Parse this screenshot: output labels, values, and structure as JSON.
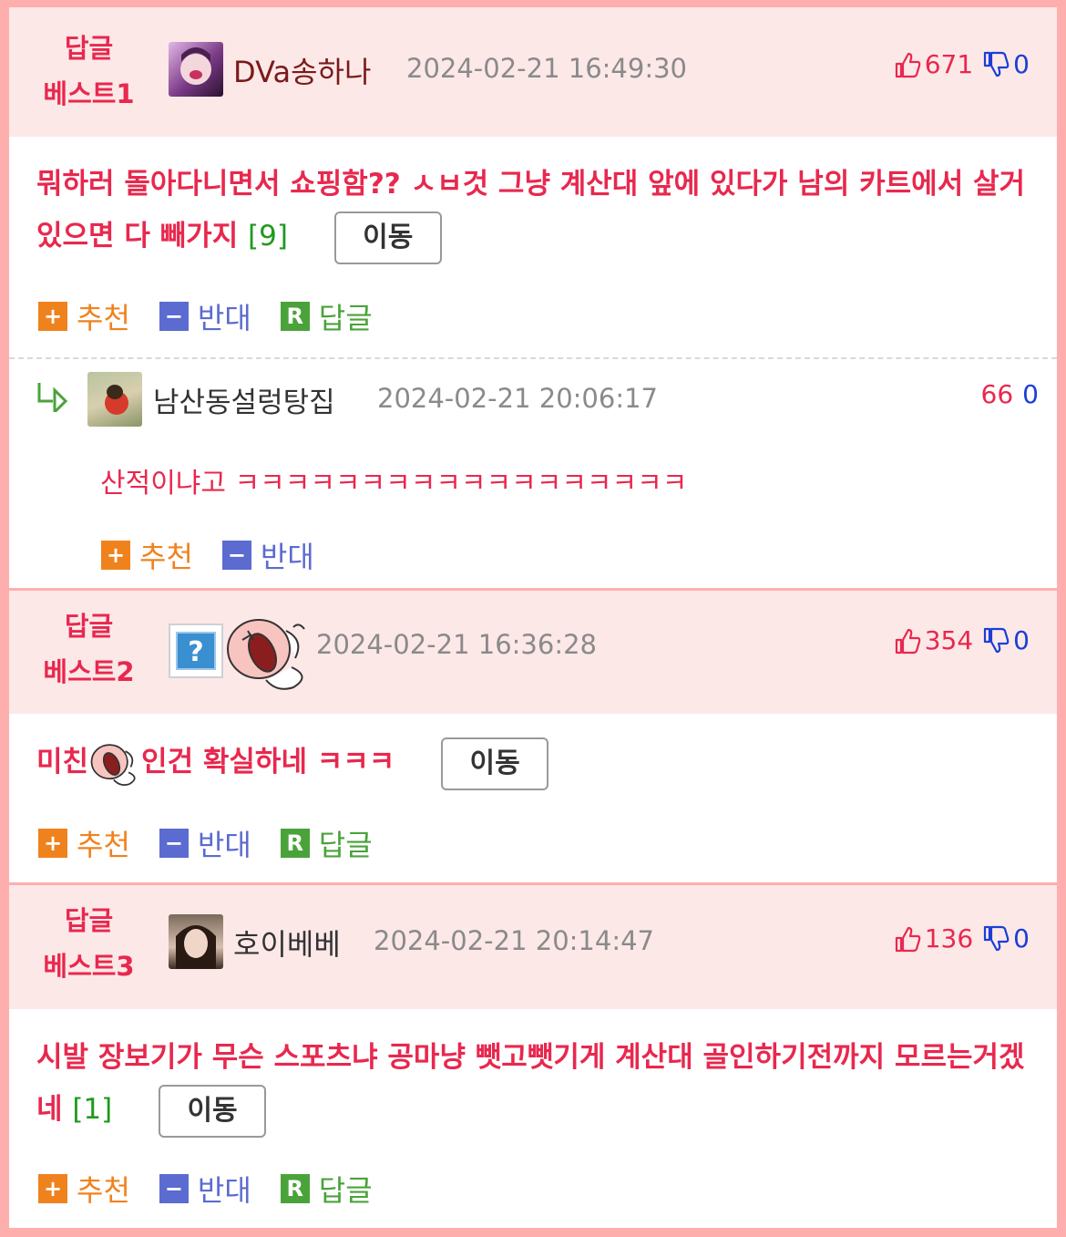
{
  "colors": {
    "accent_red": "#e8284e",
    "down_blue": "#1a3fd6",
    "header_bg": "#fde8e8",
    "border_pink": "#ffaeae"
  },
  "actions": {
    "recommend": "추천",
    "oppose": "반대",
    "reply": "답글",
    "move": "이동",
    "plus": "+",
    "minus": "−",
    "reply_icon": "R"
  },
  "best1": {
    "tag_line1": "답글",
    "tag_line2": "베스트1",
    "nick": "DVa송하나",
    "time": "2024-02-21 16:49:30",
    "up": "671",
    "down": "0",
    "text": "뭐하러 돌아다니면서 쇼핑함?? ㅅㅂ것 그냥 계산대 앞에 있다가 남의 카트에서 살거있으면 다 빼가지",
    "reply_count": "[9]",
    "sub": {
      "nick": "남산동설렁탕집",
      "time": "2024-02-21 20:06:17",
      "up": "66",
      "down": "0",
      "text": "산적이냐고 ㅋㅋㅋㅋㅋㅋㅋㅋㅋㅋㅋㅋㅋㅋㅋㅋㅋㅋ"
    }
  },
  "best2": {
    "tag_line1": "답글",
    "tag_line2": "베스트2",
    "avatar_placeholder": "?",
    "time": "2024-02-21 16:36:28",
    "up": "354",
    "down": "0",
    "text_before": "미친",
    "text_after": "인건 확실하네 ㅋㅋㅋ"
  },
  "best3": {
    "tag_line1": "답글",
    "tag_line2": "베스트3",
    "nick": "호이베베",
    "time": "2024-02-21 20:14:47",
    "up": "136",
    "down": "0",
    "text": "시발 장보기가 무슨 스포츠냐 공마냥 뺏고뺏기게 계산대 골인하기전까지 모르는거겠네",
    "reply_count": "[1]"
  }
}
